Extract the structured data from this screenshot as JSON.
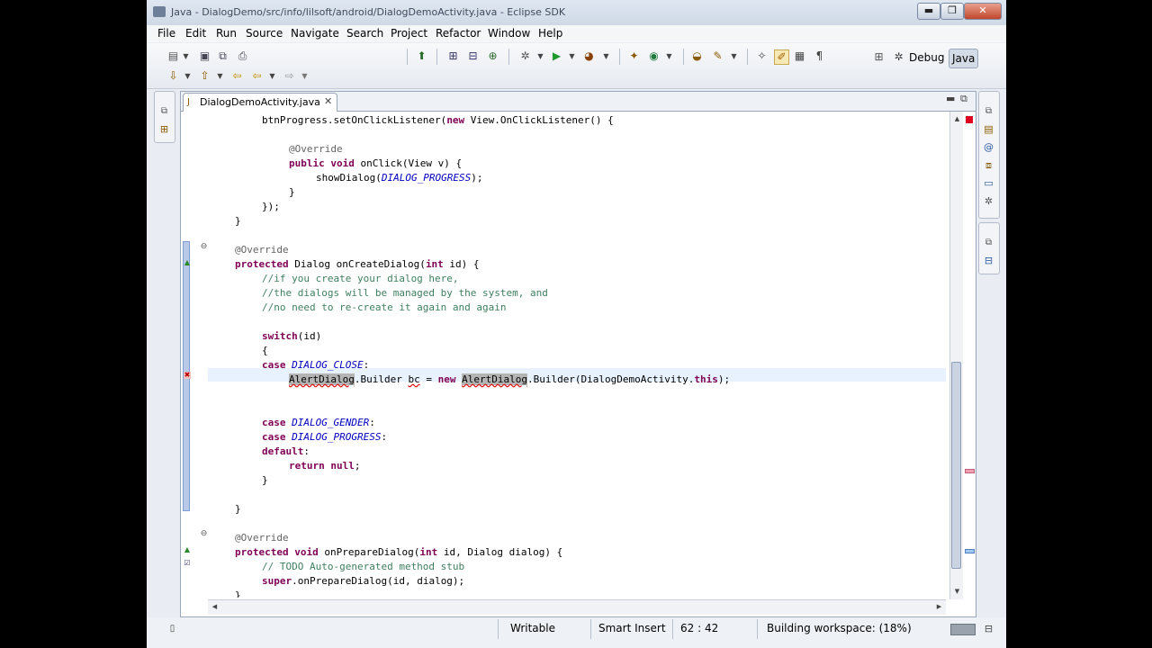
{
  "window": {
    "title": "Java - DialogDemo/src/info/lilsoft/android/DialogDemoActivity.java - Eclipse SDK",
    "buttons": {
      "minimize": "▬",
      "maximize": "❐",
      "close": "✕"
    }
  },
  "menu": [
    "File",
    "Edit",
    "Run",
    "Source",
    "Navigate",
    "Search",
    "Project",
    "Refactor",
    "Window",
    "Help"
  ],
  "perspectives": {
    "debug": "Debug",
    "java": "Java"
  },
  "editor": {
    "tab_label": "DialogDemoActivity.java",
    "tab_close": "✕",
    "view_min": "▬",
    "view_max": "⧉",
    "lines": [
      {
        "indent": 2,
        "tokens": [
          {
            "t": "btnProgress.setOnClickListener("
          },
          {
            "t": "new",
            "c": "kw"
          },
          {
            "t": " View.OnClickListener() {"
          }
        ]
      },
      {
        "indent": 0,
        "tokens": []
      },
      {
        "indent": 3,
        "tokens": [
          {
            "t": "@Override",
            "c": "an"
          }
        ]
      },
      {
        "indent": 3,
        "tokens": [
          {
            "t": "public",
            "c": "kw"
          },
          {
            "t": " "
          },
          {
            "t": "void",
            "c": "kw"
          },
          {
            "t": " onClick(View v) {"
          }
        ]
      },
      {
        "indent": 4,
        "tokens": [
          {
            "t": "showDialog("
          },
          {
            "t": "DIALOG_PROGRESS",
            "c": "it"
          },
          {
            "t": ");"
          }
        ]
      },
      {
        "indent": 3,
        "tokens": [
          {
            "t": "}"
          }
        ]
      },
      {
        "indent": 2,
        "tokens": [
          {
            "t": "});"
          }
        ]
      },
      {
        "indent": 1,
        "tokens": [
          {
            "t": "}"
          }
        ]
      },
      {
        "indent": 0,
        "tokens": []
      },
      {
        "indent": 1,
        "tokens": [
          {
            "t": "@Override",
            "c": "an"
          }
        ]
      },
      {
        "indent": 1,
        "tokens": [
          {
            "t": "protected",
            "c": "kw"
          },
          {
            "t": " Dialog onCreateDialog("
          },
          {
            "t": "int",
            "c": "kw"
          },
          {
            "t": " id) {"
          }
        ]
      },
      {
        "indent": 2,
        "tokens": [
          {
            "t": "//if you create your dialog here,",
            "c": "cm"
          }
        ]
      },
      {
        "indent": 2,
        "tokens": [
          {
            "t": "//the dialogs will be managed by the system, and",
            "c": "cm"
          }
        ]
      },
      {
        "indent": 2,
        "tokens": [
          {
            "t": "//no need to re-create it again and again",
            "c": "cm"
          }
        ]
      },
      {
        "indent": 0,
        "tokens": []
      },
      {
        "indent": 2,
        "tokens": [
          {
            "t": "switch",
            "c": "kw"
          },
          {
            "t": "(id)"
          }
        ]
      },
      {
        "indent": 2,
        "tokens": [
          {
            "t": "{"
          }
        ]
      },
      {
        "indent": 2,
        "tokens": [
          {
            "t": "case",
            "c": "kw"
          },
          {
            "t": " "
          },
          {
            "t": "DIALOG_CLOSE",
            "c": "it"
          },
          {
            "t": ":"
          }
        ]
      },
      {
        "indent": 3,
        "tokens": [
          {
            "t": "AlertDialog",
            "c": "hl err"
          },
          {
            "t": ".Builder "
          },
          {
            "t": "bc",
            "c": "err"
          },
          {
            "t": " = "
          },
          {
            "t": "new",
            "c": "kw"
          },
          {
            "t": " "
          },
          {
            "t": "AlertDialog",
            "c": "hl err"
          },
          {
            "t": ".Builder(DialogDemoActivity."
          },
          {
            "t": "this",
            "c": "kw"
          },
          {
            "t": ");"
          }
        ]
      },
      {
        "indent": 0,
        "tokens": []
      },
      {
        "indent": 0,
        "tokens": []
      },
      {
        "indent": 2,
        "tokens": [
          {
            "t": "case",
            "c": "kw"
          },
          {
            "t": " "
          },
          {
            "t": "DIALOG_GENDER",
            "c": "it"
          },
          {
            "t": ":"
          }
        ]
      },
      {
        "indent": 2,
        "tokens": [
          {
            "t": "case",
            "c": "kw"
          },
          {
            "t": " "
          },
          {
            "t": "DIALOG_PROGRESS",
            "c": "it"
          },
          {
            "t": ":"
          }
        ]
      },
      {
        "indent": 2,
        "tokens": [
          {
            "t": "default",
            "c": "kw"
          },
          {
            "t": ":"
          }
        ]
      },
      {
        "indent": 3,
        "tokens": [
          {
            "t": "return",
            "c": "kw"
          },
          {
            "t": " "
          },
          {
            "t": "null",
            "c": "kw"
          },
          {
            "t": ";"
          }
        ]
      },
      {
        "indent": 2,
        "tokens": [
          {
            "t": "}"
          }
        ]
      },
      {
        "indent": 0,
        "tokens": []
      },
      {
        "indent": 1,
        "tokens": [
          {
            "t": "}"
          }
        ]
      },
      {
        "indent": 0,
        "tokens": []
      },
      {
        "indent": 1,
        "tokens": [
          {
            "t": "@Override",
            "c": "an"
          }
        ]
      },
      {
        "indent": 1,
        "tokens": [
          {
            "t": "protected",
            "c": "kw"
          },
          {
            "t": " "
          },
          {
            "t": "void",
            "c": "kw"
          },
          {
            "t": " onPrepareDialog("
          },
          {
            "t": "int",
            "c": "kw"
          },
          {
            "t": " id, Dialog dialog) {"
          }
        ]
      },
      {
        "indent": 2,
        "tokens": [
          {
            "t": "// TODO Auto-generated method stub",
            "c": "cm"
          }
        ]
      },
      {
        "indent": 2,
        "tokens": [
          {
            "t": "super",
            "c": "kw"
          },
          {
            "t": ".onPrepareDialog(id, dialog);"
          }
        ]
      },
      {
        "indent": 1,
        "tokens": [
          {
            "t": "}"
          }
        ]
      }
    ]
  },
  "status": {
    "writable": "Writable",
    "insert_mode": "Smart Insert",
    "position": "62 : 42",
    "build": "Building workspace: (18%)"
  },
  "colors": {
    "keyword": "#7f0055",
    "comment": "#3f7f5f",
    "constant": "#0000c0",
    "annotation": "#646464"
  }
}
